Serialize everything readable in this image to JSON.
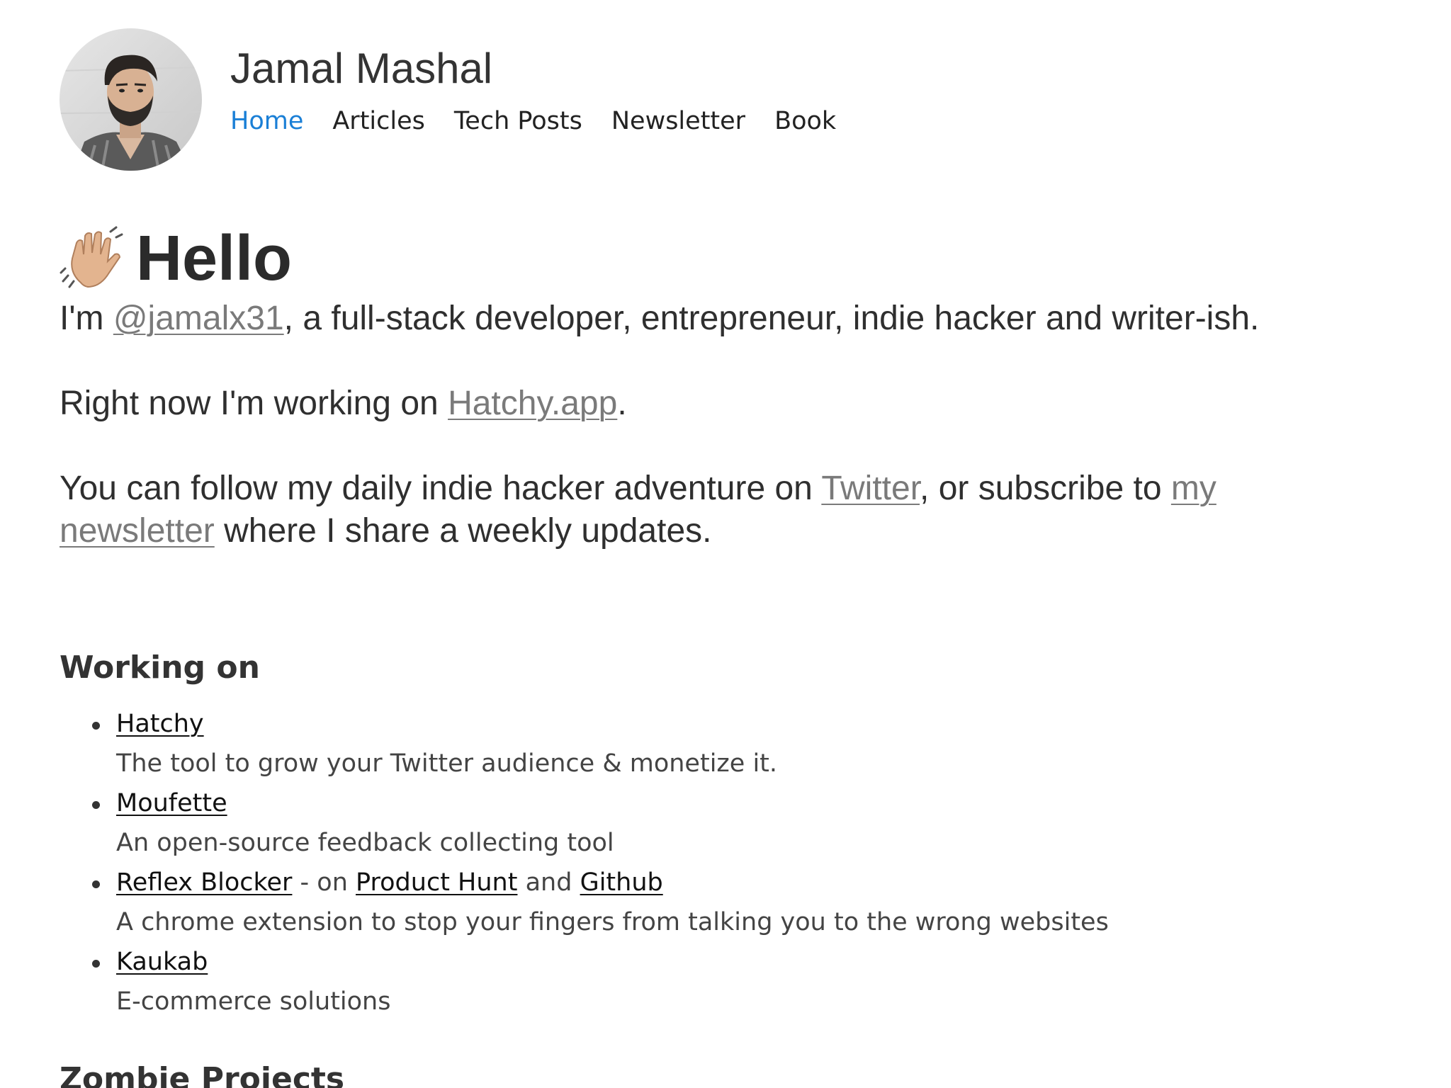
{
  "header": {
    "site_title": "Jamal Mashal",
    "avatar_icon": "profile-photo",
    "nav": [
      {
        "label": "Home",
        "active": true
      },
      {
        "label": "Articles",
        "active": false
      },
      {
        "label": "Tech Posts",
        "active": false
      },
      {
        "label": "Newsletter",
        "active": false
      },
      {
        "label": "Book",
        "active": false
      }
    ]
  },
  "intro": {
    "wave_icon": "waving-hand-emoji",
    "heading": "Hello",
    "p1": {
      "pre": "I'm ",
      "handle": "@jamalx31",
      "post": ", a full-stack developer, entrepreneur, indie hacker and writer-ish."
    },
    "p2": {
      "pre": "Right now I'm working on ",
      "link": "Hatchy.app",
      "post": "."
    },
    "p3": {
      "pre": "You can follow my daily indie hacker adventure on ",
      "twitter": "Twitter",
      "mid": ", or subscribe to ",
      "newsletter": "my newsletter",
      "post": " where I share a weekly updates."
    }
  },
  "working_on": {
    "heading": "Working on",
    "projects": [
      {
        "name": "Hatchy",
        "desc": "The tool to grow your Twitter audience & monetize it."
      },
      {
        "name": "Moufette",
        "desc": "An open-source feedback collecting tool"
      },
      {
        "name": "Reflex Blocker",
        "extra_pre": " - on ",
        "extra_link1": "Product Hunt",
        "extra_mid": " and ",
        "extra_link2": "Github",
        "desc": "A chrome extension to stop your fingers from talking you to the wrong websites"
      },
      {
        "name": "Kaukab",
        "desc": "E-commerce solutions"
      }
    ]
  },
  "zombie": {
    "heading": "Zombie Projects"
  },
  "colors": {
    "nav_active": "#1a7fd6",
    "link_muted": "#7a7a7a",
    "text": "#333333"
  }
}
